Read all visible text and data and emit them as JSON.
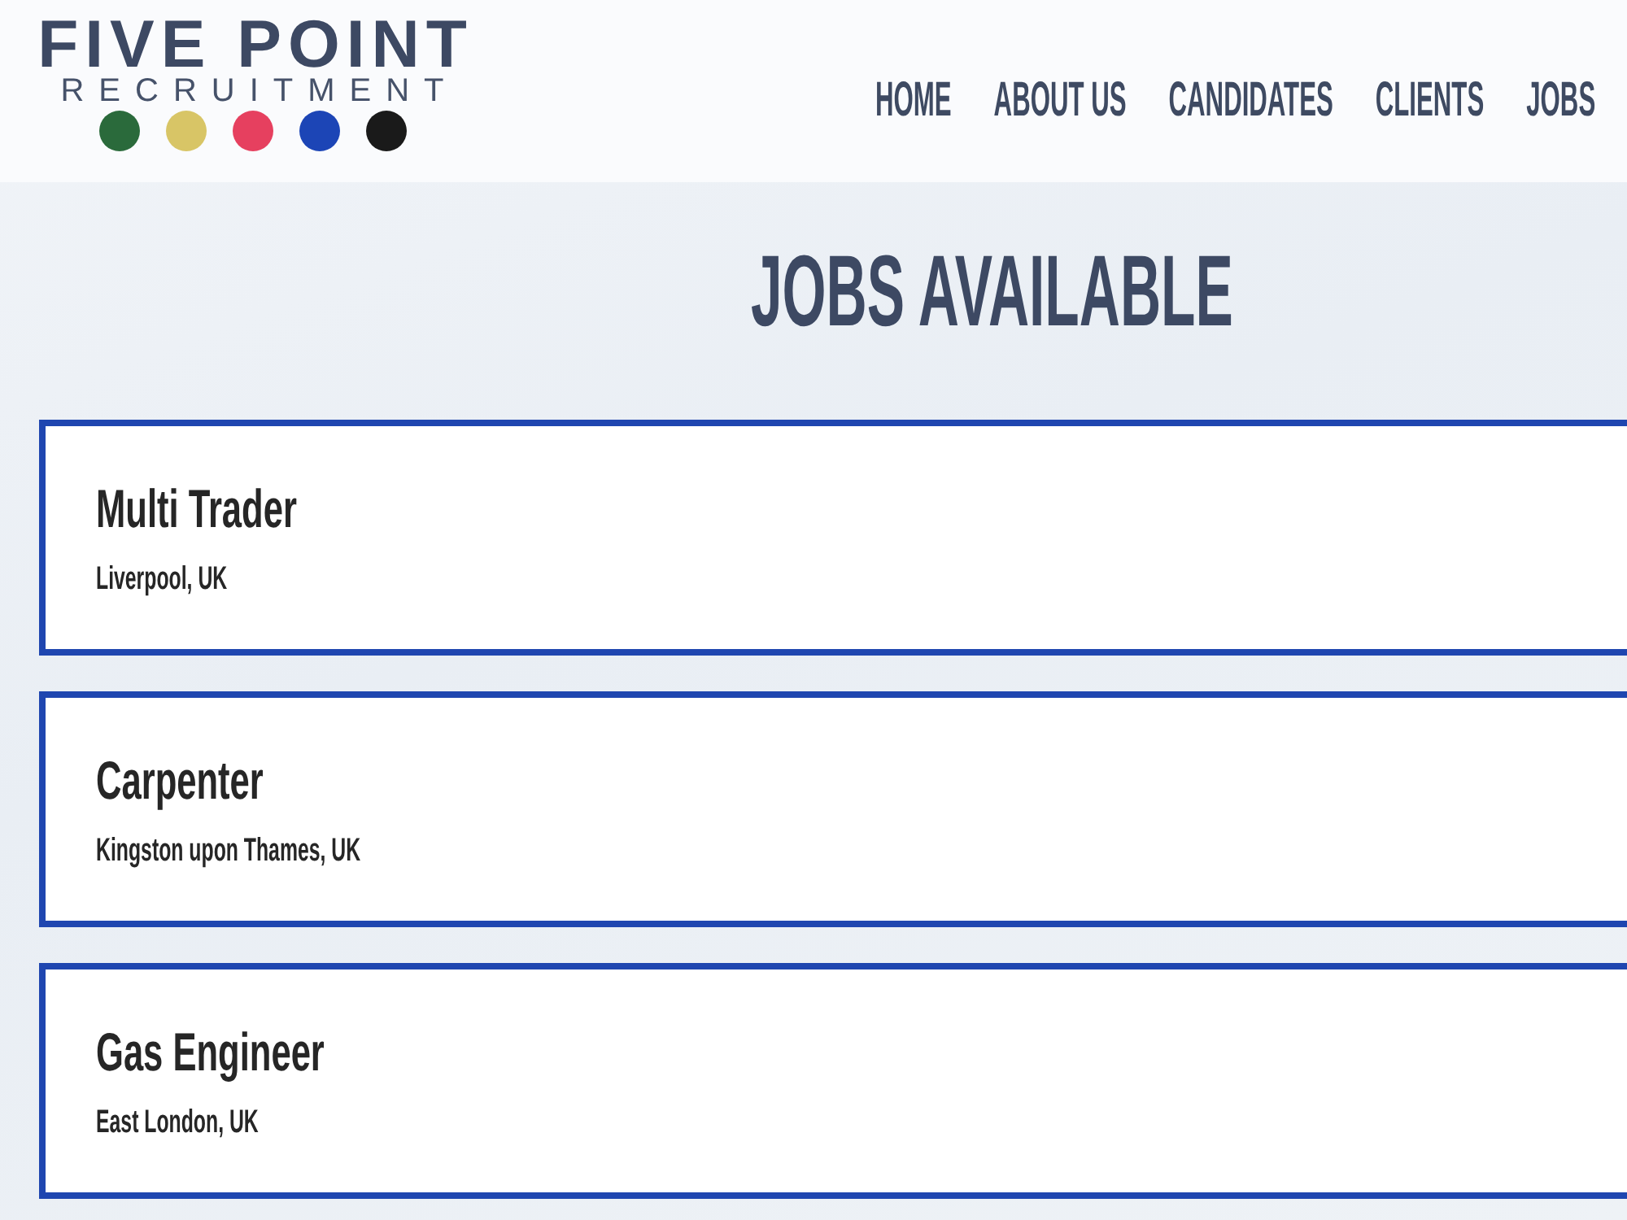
{
  "logo": {
    "name": "FIVE POINT",
    "tagline": "RECRUITMENT",
    "dots": [
      {
        "color": "#2a6a3b"
      },
      {
        "color": "#d8c566"
      },
      {
        "color": "#e6405f"
      },
      {
        "color": "#1c45b6"
      },
      {
        "color": "#1a1a1a"
      }
    ]
  },
  "nav": [
    {
      "label": "HOME"
    },
    {
      "label": "ABOUT US"
    },
    {
      "label": "CANDIDATES"
    },
    {
      "label": "CLIENTS"
    },
    {
      "label": "JOBS"
    }
  ],
  "page_title": "JOBS AVAILABLE",
  "jobs": [
    {
      "title": "Multi Trader",
      "location": "Liverpool, UK"
    },
    {
      "title": "Carpenter",
      "location": "Kingston upon Thames, UK"
    },
    {
      "title": "Gas Engineer",
      "location": "East London, UK"
    }
  ]
}
